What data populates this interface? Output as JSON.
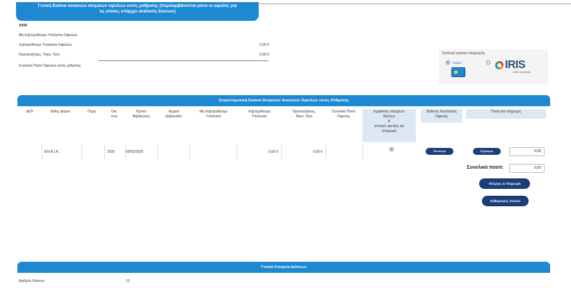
{
  "summary": {
    "title_line1": "Γενική Εικόνα ανοικτών ατομικών οφειλών εκτός ρύθμισης (περιλαμβάνονται μόνο οι οφειλές για",
    "title_line2": "τις οποίες υπάρχει ανάλυση δόσεων)",
    "afm_label": "ΑΦΜ",
    "rows": [
      {
        "label": "Μη Ληξιπρόθεσμο Υπόλοιπο Οφειλών",
        "value": ""
      },
      {
        "label": "Ληξιπρόθεσμο Υπόλοιπο Οφειλών",
        "value": "0,00 €"
      },
      {
        "label": "Προσαυξήσεις, Τόκοι, Τέλη",
        "value": "0,00 €"
      },
      {
        "label": "Συνολικό Ποσό Οφειλών εκτός ρύθμισης",
        "value": ""
      }
    ]
  },
  "payment": {
    "label": "Επιλογή τρόπου πληρωμής",
    "card_label": "Κάρτα",
    "iris_name": "IRIS",
    "iris_sub": "online payments"
  },
  "table": {
    "title": "Συγκεντρωτική Εικόνα Ατομικών Ανοικτών Οφειλών εκτός Ρύθμισης",
    "headers": {
      "doy": "ΔΟΥ",
      "tax_type": "Είδος φόρου",
      "source": "Πηγή",
      "fin_year_1": "Οικ.",
      "fin_year_2": "έτος",
      "cert_date_1": "Ημ/νία",
      "cert_date_2": "Βεβαίωσης",
      "initial_1": "Αρχικό",
      "initial_2": "βεβαιωθέν",
      "not_overdue_1": "Μη Ληξιπρόθεσμο",
      "not_overdue_2": "Υπόλοιπο",
      "overdue_1": "Ληξιπρόθεσμο",
      "overdue_2": "Υπόλοιπο",
      "surcharges_1": "Προσαυξήσεις,",
      "surcharges_2": "Τόκοι, Τέλη",
      "total_1": "Συνολικό Ποσό",
      "total_2": "Οφειλής",
      "show_1": "Εμφάνιση στοιχείων",
      "show_2": "δόσεων",
      "show_3": "&",
      "show_4": "επιλογή οφειλής για",
      "show_5": "πληρωμή",
      "issue_1": "Έκδοση Ταυτότητας",
      "issue_2": "Οφειλής",
      "pay_amount": "Ποσό για πληρωμή"
    },
    "row": {
      "tax_type": "ΕΝ.Φ.Ι.Α.",
      "fin_year": "2025",
      "cert_date": "09/03/2025",
      "overdue": "0,00 €",
      "surcharges": "0,00 €",
      "issue_btn": "Ταυτότητα",
      "show_btn": "Εξόφληση",
      "amount": "0,00"
    },
    "total_label": "Συνολικό ποσό:",
    "total_value": "0,00",
    "check_pay_btn": "Έλεγχος & Πληρωμή",
    "clear_btn": "Καθαρισμός ποσών"
  },
  "general": {
    "title": "Γενικά Στοιχεία Δόσεων",
    "installments_label": "Αριθμός δόσεων",
    "installments_value": "12"
  },
  "colors": {
    "primary_blue": "#1e88d2",
    "dark_button": "#1b3f7a",
    "header_cell": "#dce9f5"
  }
}
